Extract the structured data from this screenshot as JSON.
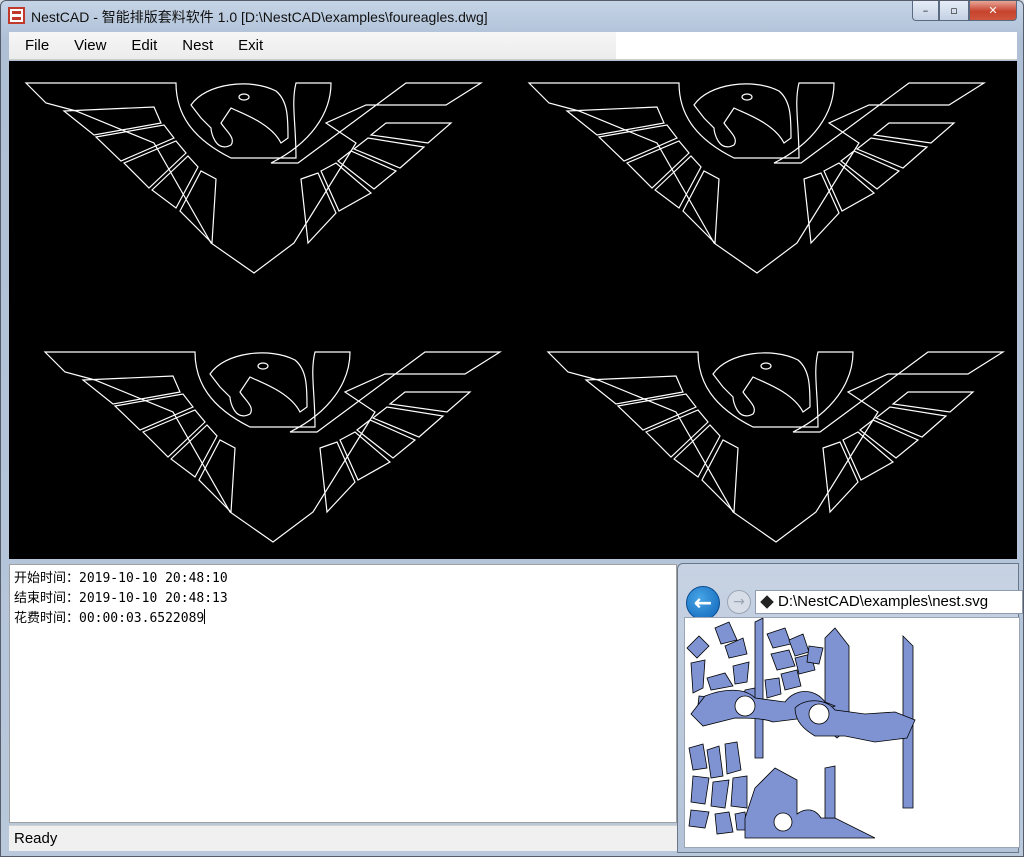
{
  "window": {
    "title": "NestCAD - 智能排版套料软件 1.0 [D:\\NestCAD\\examples\\foureagles.dwg]",
    "controls": {
      "minimize": "–",
      "maximize": "▫",
      "close": "✕"
    }
  },
  "menu": {
    "items": [
      {
        "label": "File"
      },
      {
        "label": "View"
      },
      {
        "label": "Edit"
      },
      {
        "label": "Nest"
      },
      {
        "label": "Exit"
      }
    ]
  },
  "log": {
    "lines": [
      "开始时间：2019-10-10 20:48:10",
      "结束时间：2019-10-10 20:48:13",
      "花费时间：00:00:03.6522089"
    ]
  },
  "statusbar": {
    "text": "Ready"
  },
  "preview": {
    "address": "D:\\NestCAD\\examples\\nest.svg",
    "back_icon": "arrow-left-icon",
    "forward_icon": "arrow-right-icon"
  },
  "colors": {
    "canvas_bg": "#000000",
    "outline": "#ffffff",
    "nested_fill": "#7f93d3"
  }
}
